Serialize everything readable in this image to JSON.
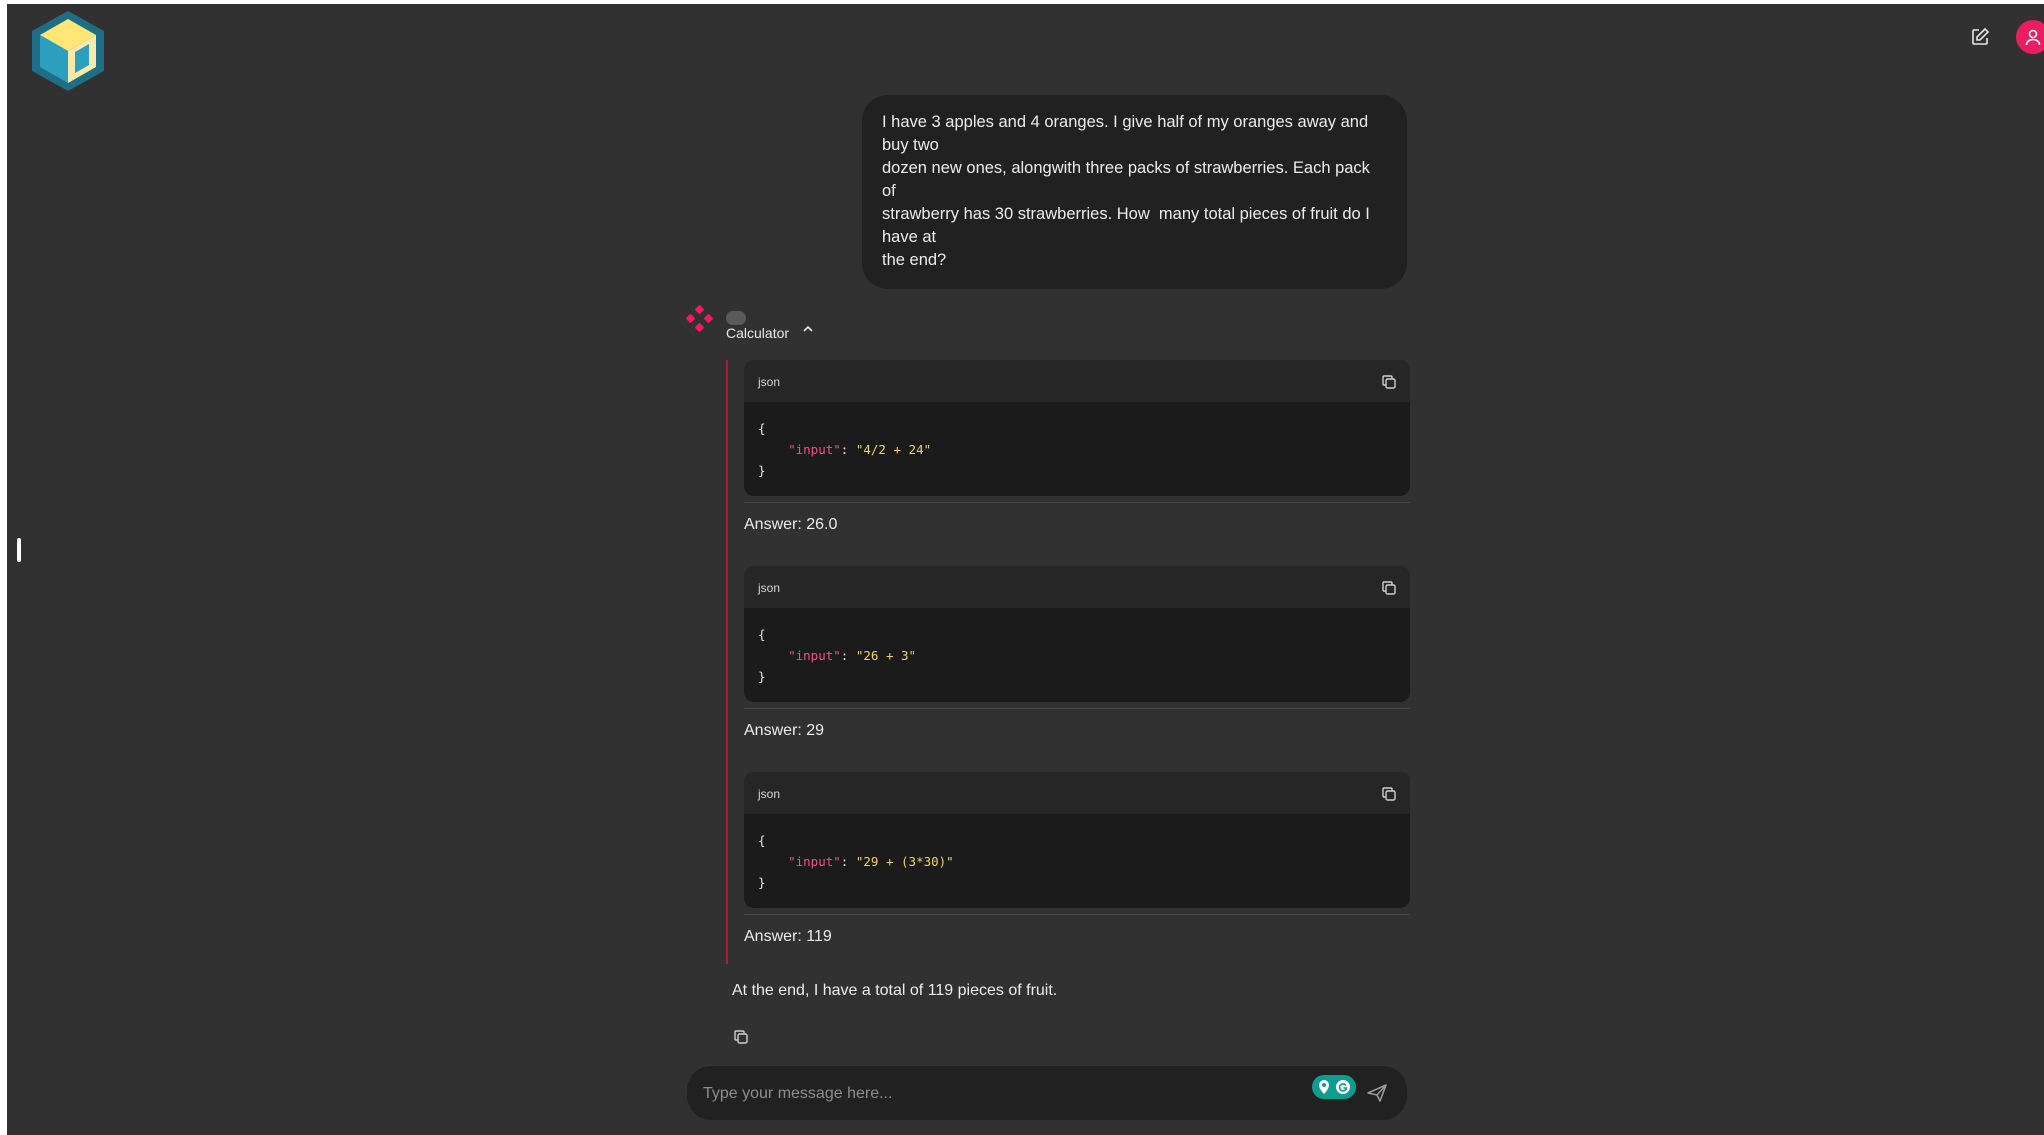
{
  "user_message": "I have 3 apples and 4 oranges. I give half of my oranges away and buy two\ndozen new ones, alongwith three packs of strawberries. Each pack of\nstrawberry has 30 strawberries. How  many total pieces of fruit do I have at\nthe end?",
  "tool": {
    "name": "Calculator",
    "calls": [
      {
        "lang": "json",
        "open": "{",
        "key": "\"input\"",
        "sep": ": ",
        "value": "\"4/2 + 24\"",
        "close": "}",
        "answer": "Answer: 26.0"
      },
      {
        "lang": "json",
        "open": "{",
        "key": "\"input\"",
        "sep": ": ",
        "value": "\"26 + 3\"",
        "close": "}",
        "answer": "Answer: 29"
      },
      {
        "lang": "json",
        "open": "{",
        "key": "\"input\"",
        "sep": ": ",
        "value": "\"29 + (3*30)\"",
        "close": "}",
        "answer": "Answer: 119"
      }
    ]
  },
  "final_answer": "At the end, I have a total of 119 pieces of fruit.",
  "composer": {
    "placeholder": "Type your message here..."
  },
  "colors": {
    "accent": "#ea1d63",
    "background": "#313131",
    "bubble": "#212121",
    "code_key": "#f0508a",
    "code_value": "#f0d36a",
    "tool_border": "#b8163f"
  },
  "icons": {
    "logo": "cube-logo-icon",
    "edit": "edit-icon",
    "avatar": "user-icon",
    "assistant": "assistant-icon",
    "copy": "copy-icon",
    "send": "send-icon",
    "caret": "chevron-up-icon"
  }
}
